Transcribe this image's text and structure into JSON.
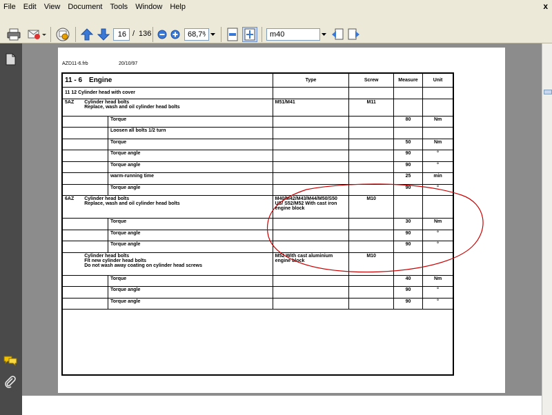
{
  "menubar": {
    "items": [
      "File",
      "Edit",
      "View",
      "Document",
      "Tools",
      "Window",
      "Help"
    ],
    "close": "x"
  },
  "toolbar": {
    "page_current": "16",
    "page_separator": "/",
    "page_total": "136",
    "zoom": "68,7%",
    "search": "m40",
    "icons": [
      "printer-icon",
      "email-icon",
      "review-icon",
      "previous-page-icon",
      "next-page-icon",
      "zoom-out-icon",
      "zoom-in-icon",
      "fit-width-icon",
      "fit-page-icon",
      "search-previous-icon",
      "search-next-icon"
    ]
  },
  "document": {
    "file": "AZD11-6.frb",
    "date": "20/10/97",
    "section_code": "11 - 6",
    "section_title": "Engine",
    "columns": {
      "type": "Type",
      "screw": "Screw",
      "measure": "Measure",
      "unit": "Unit"
    },
    "group_title": "11 12  Cylinder head with cover",
    "groups": [
      {
        "code": "5AZ",
        "lines": [
          "Cylinder head bolts",
          "Replace, wash and oil cylinder head bolts"
        ],
        "type": "M51/M41",
        "screw": "M11",
        "steps": [
          {
            "label": "Torque",
            "measure": "80",
            "unit": "Nm"
          },
          {
            "label": "Loosen all bolts 1/2 turn",
            "measure": "",
            "unit": ""
          },
          {
            "label": "Torque",
            "measure": "50",
            "unit": "Nm"
          },
          {
            "label": "Torque angle",
            "measure": "90",
            "unit": "°"
          },
          {
            "label": "Torque angle",
            "measure": "90",
            "unit": "°"
          },
          {
            "label": "warm-running time",
            "measure": "25",
            "unit": "min"
          },
          {
            "label": "Torque angle",
            "measure": "90",
            "unit": "°"
          }
        ]
      },
      {
        "code": "6AZ",
        "lines": [
          "Cylinder head bolts",
          "Replace, wash and oil cylinder head bolts"
        ],
        "type": "M40/M42/M43/M44/M50/S50 US/ S52/M52 With cast iron engine block",
        "screw": "M10",
        "steps": [
          {
            "label": "Torque",
            "measure": "30",
            "unit": "Nm"
          },
          {
            "label": "Torque angle",
            "measure": "90",
            "unit": "°"
          },
          {
            "label": "Torque angle",
            "measure": "90",
            "unit": "°"
          }
        ]
      },
      {
        "code": "",
        "lines": [
          "Cylinder head bolts",
          "Fit new cylinder head bolts",
          "Do not wash away coating on cylinder head screws"
        ],
        "type": "M52 With cast aluminium engine block",
        "screw": "M10",
        "steps": [
          {
            "label": "Torque",
            "measure": "40",
            "unit": "Nm"
          },
          {
            "label": "Torque angle",
            "measure": "90",
            "unit": "°"
          },
          {
            "label": "Torque angle",
            "measure": "90",
            "unit": "°"
          }
        ]
      }
    ]
  },
  "colors": {
    "annotation": "#cc0000",
    "toolbar_bg": "#ece9d8",
    "viewport_bg": "#8c8c8c",
    "left_panel_bg": "#4a4a4a"
  }
}
